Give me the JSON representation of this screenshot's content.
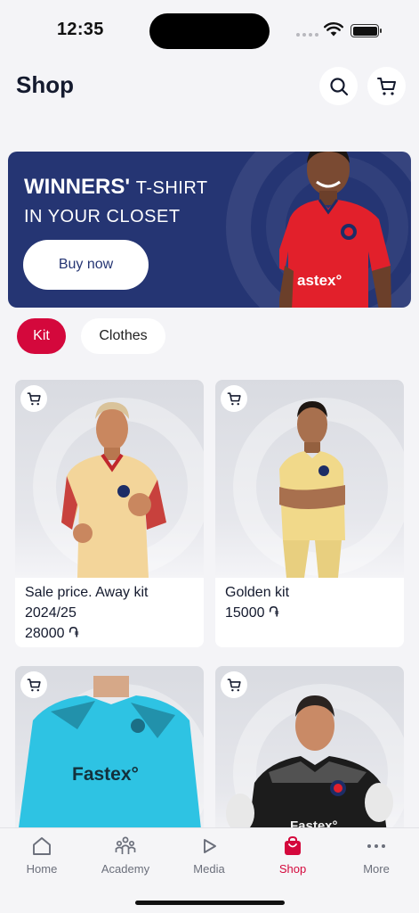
{
  "status_bar": {
    "time": "12:35"
  },
  "header": {
    "title": "Shop",
    "search_icon": "search-icon",
    "cart_icon": "cart-icon"
  },
  "banner": {
    "line1_bold": "WINNERS'",
    "line1_light": "T-SHIRT",
    "line2": "IN YOUR CLOSET",
    "button_label": "Buy now",
    "sponsor": "astex°",
    "bg_color": "#253573"
  },
  "categories": [
    {
      "label": "Kit",
      "active": true
    },
    {
      "label": "Clothes",
      "active": false
    }
  ],
  "products": [
    {
      "title": "Sale price. Away kit 2024/25",
      "price": "28000 ֏",
      "jersey": "#f3d59a"
    },
    {
      "title": "Golden kit",
      "price": "15000 ֏",
      "jersey": "#f1d98a"
    },
    {
      "title": "",
      "price": "",
      "jersey": "#2ec3e3",
      "sponsor": "Fastex°"
    },
    {
      "title": "",
      "price": "",
      "jersey": "#1c1c1c",
      "sponsor": "Fastex°"
    }
  ],
  "bottom_nav": [
    {
      "label": "Home",
      "icon": "home-icon",
      "active": false
    },
    {
      "label": "Academy",
      "icon": "academy-icon",
      "active": false
    },
    {
      "label": "Media",
      "icon": "media-icon",
      "active": false
    },
    {
      "label": "Shop",
      "icon": "shop-icon",
      "active": true
    },
    {
      "label": "More",
      "icon": "more-icon",
      "active": false
    }
  ],
  "colors": {
    "accent": "#d4083c",
    "navy": "#253573",
    "background": "#f4f4f7"
  }
}
